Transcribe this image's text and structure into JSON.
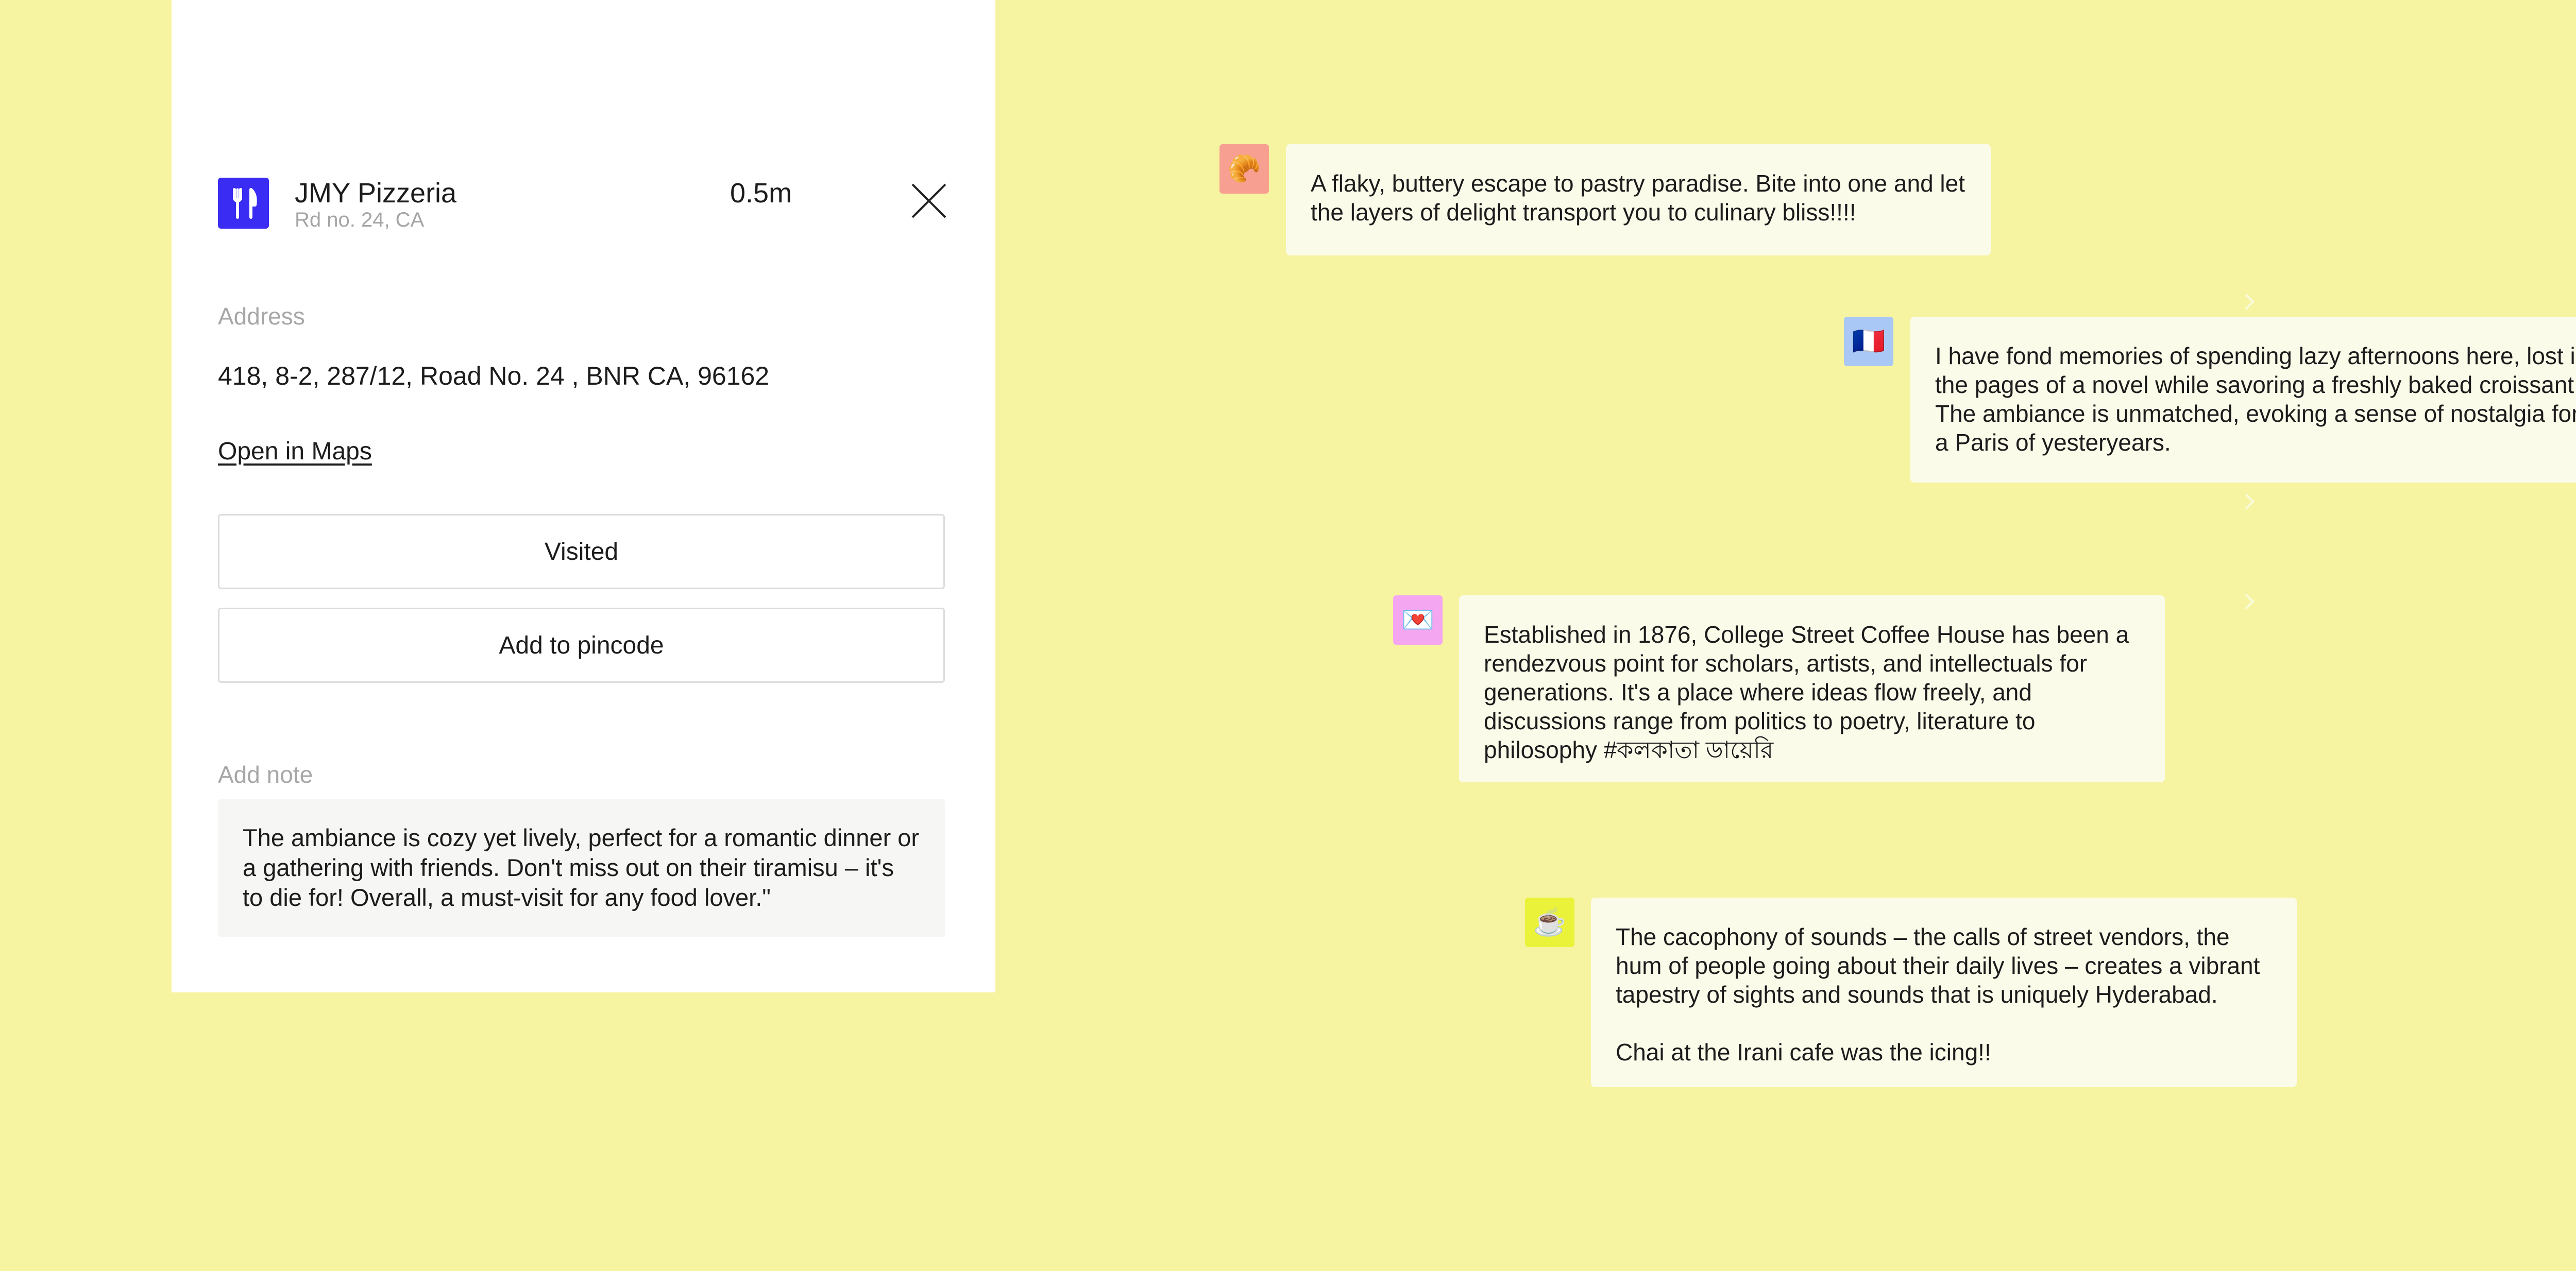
{
  "place": {
    "name": "JMY Pizzeria",
    "subtitle": "Rd no. 24, CA",
    "distance": "0.5m",
    "icon": "utensils-icon",
    "icon_color": "#3b2cf3"
  },
  "address": {
    "label": "Address",
    "value": "418, 8-2, 287/12, Road No. 24 , BNR CA, 96162",
    "maps_link": "Open in Maps"
  },
  "actions": {
    "visited_label": "Visited",
    "pincode_label": "Add to pincode"
  },
  "note": {
    "label": "Add note",
    "value": "The ambiance is cozy yet lively, perfect for a romantic dinner or a gathering with friends. Don't miss out on their tiramisu – it's to die for! Overall, a must-visit for any food lover.\""
  },
  "reviews": [
    {
      "avatar": "🥐",
      "avatar_color": "#f7a091",
      "paragraphs": [
        "A flaky, buttery escape to pastry paradise. Bite into one and let the layers of delight transport you to culinary bliss!!!!"
      ]
    },
    {
      "avatar": "🇫🇷",
      "avatar_color": "#a9c8f5",
      "paragraphs": [
        "I have fond memories of spending lazy afternoons here, lost in the pages of a novel while savoring a freshly baked croissant. The ambiance is unmatched, evoking a sense of nostalgia for a Paris of yesteryears."
      ]
    },
    {
      "avatar": "💌",
      "avatar_color": "#f4a7f0",
      "paragraphs": [
        "Established in 1876, College Street Coffee House has been a rendezvous point for scholars, artists, and intellectuals for generations. It's a place where ideas flow freely, and discussions range from politics to poetry, literature to philosophy #কলকাতা ডায়েরি"
      ]
    },
    {
      "avatar": "☕",
      "avatar_color": "#eaf23a",
      "paragraphs": [
        "The cacophony of sounds – the calls of street vendors, the hum of people going about their daily lives – creates a vibrant tapestry of sights and sounds that is uniquely Hyderabad.",
        "Chai at the Irani cafe was the icing!!"
      ]
    }
  ]
}
